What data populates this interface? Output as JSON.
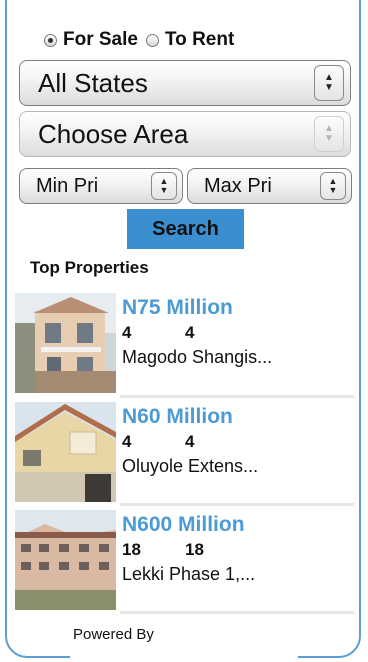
{
  "filters": {
    "for_sale_label": "For Sale",
    "to_rent_label": "To Rent",
    "state_select_value": "All States",
    "area_select_value": "Choose Area",
    "min_price_value": "Min Pri",
    "max_price_value": "Max Pri",
    "search_label": "Search",
    "selected_option": "For Sale"
  },
  "section_title": "Top Properties",
  "properties": [
    {
      "price": "N75 Million",
      "beds": "4",
      "baths": "4",
      "location": "Magodo Shangis..."
    },
    {
      "price": "N60 Million",
      "beds": "4",
      "baths": "4",
      "location": "Oluyole Extens..."
    },
    {
      "price": "N600 Million",
      "beds": "18",
      "baths": "18",
      "location": "Lekki Phase 1,..."
    }
  ],
  "footer": {
    "powered_by": "Powered By"
  },
  "colors": {
    "accent": "#3b8fcf",
    "price": "#4c9bd4",
    "frame": "#5b9fd1"
  }
}
